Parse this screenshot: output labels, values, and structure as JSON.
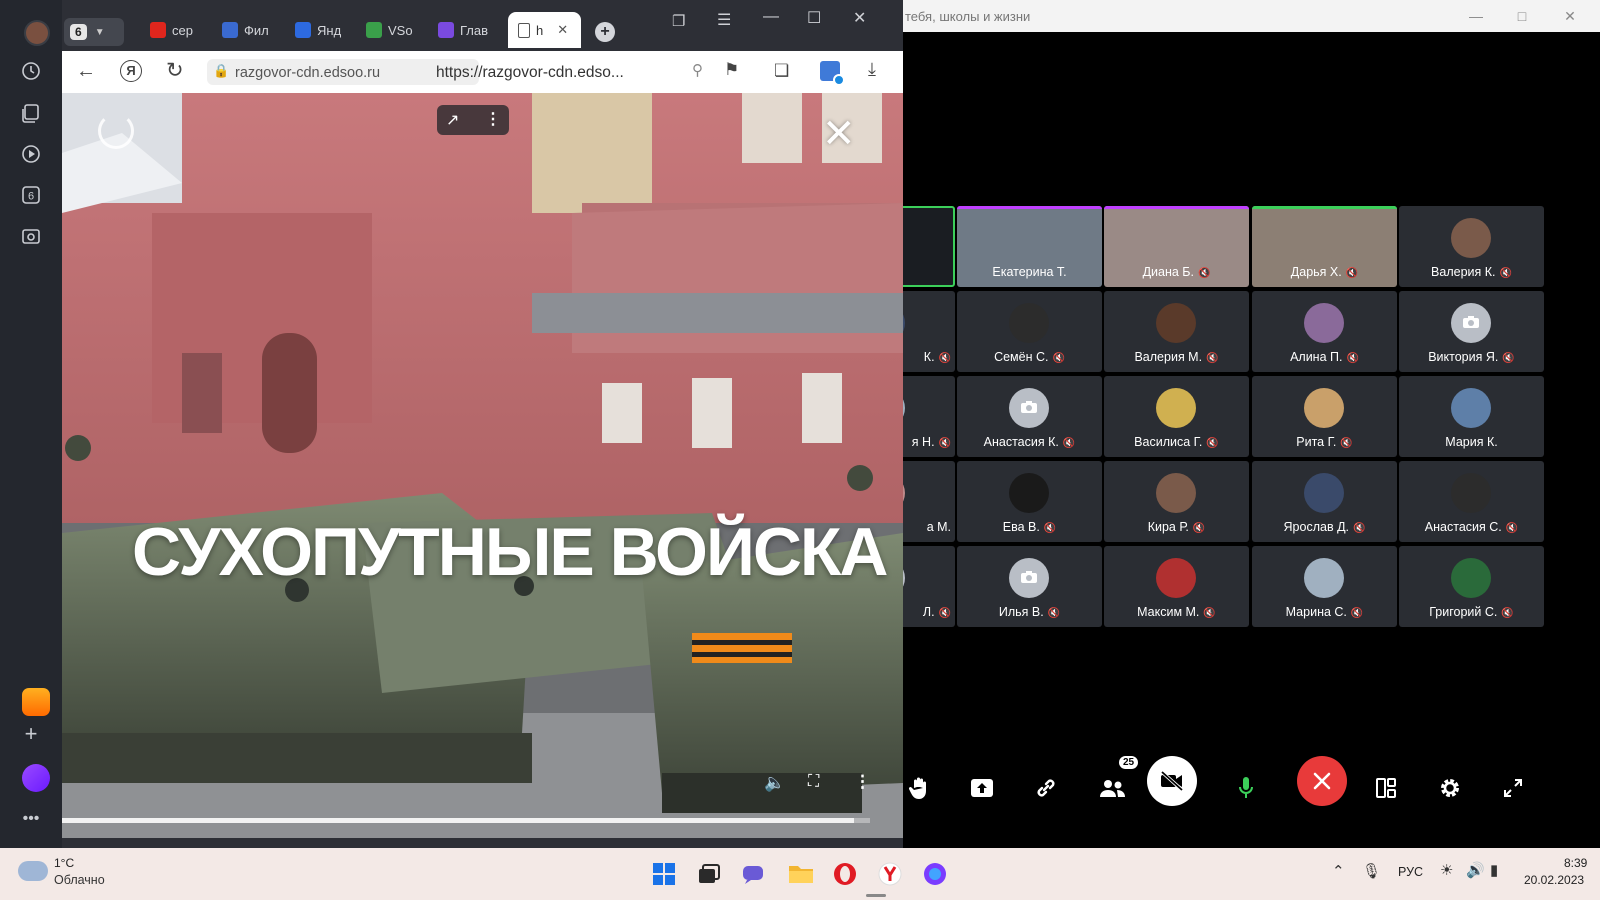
{
  "conference": {
    "window_title": "тебя, школы и жизни",
    "participant_count": "25",
    "tiles": [
      {
        "name": "",
        "kind": "screen",
        "row": 0,
        "col": 0
      },
      {
        "name": "Екатерина Т.",
        "kind": "video",
        "row": 0,
        "col": 1,
        "muted": false
      },
      {
        "name": "Диана Б.",
        "kind": "video",
        "row": 0,
        "col": 2,
        "muted": true
      },
      {
        "name": "Дарья Х.",
        "kind": "video",
        "row": 0,
        "col": 3,
        "muted": true
      },
      {
        "name": "Валерия К.",
        "kind": "avatar",
        "row": 0,
        "col": 4,
        "muted": true
      },
      {
        "name": "К.",
        "kind": "avatar",
        "row": 1,
        "col": 0,
        "muted": true
      },
      {
        "name": "Семён С.",
        "kind": "avatar",
        "row": 1,
        "col": 1,
        "muted": true
      },
      {
        "name": "Валерия М.",
        "kind": "avatar",
        "row": 1,
        "col": 2,
        "muted": true
      },
      {
        "name": "Алина П.",
        "kind": "avatar",
        "row": 1,
        "col": 3,
        "muted": true
      },
      {
        "name": "Виктория Я.",
        "kind": "camera",
        "row": 1,
        "col": 4,
        "muted": true
      },
      {
        "name": "я Н.",
        "kind": "avatar",
        "row": 2,
        "col": 0,
        "muted": true
      },
      {
        "name": "Анастасия К.",
        "kind": "camera",
        "row": 2,
        "col": 1,
        "muted": true
      },
      {
        "name": "Василиса Г.",
        "kind": "avatar",
        "row": 2,
        "col": 2,
        "muted": true
      },
      {
        "name": "Рита Г.",
        "kind": "avatar",
        "row": 2,
        "col": 3,
        "muted": true
      },
      {
        "name": "Мария К.",
        "kind": "avatar",
        "row": 2,
        "col": 4,
        "muted": false
      },
      {
        "name": "а М.",
        "kind": "avatar",
        "row": 3,
        "col": 0,
        "muted": false
      },
      {
        "name": "Ева В.",
        "kind": "avatar",
        "row": 3,
        "col": 1,
        "muted": true
      },
      {
        "name": "Кира Р.",
        "kind": "avatar",
        "row": 3,
        "col": 2,
        "muted": true
      },
      {
        "name": "Ярослав Д.",
        "kind": "avatar",
        "row": 3,
        "col": 3,
        "muted": true
      },
      {
        "name": "Анастасия С.",
        "kind": "avatar",
        "row": 3,
        "col": 4,
        "muted": true
      },
      {
        "name": "Л.",
        "kind": "camera",
        "row": 4,
        "col": 0,
        "muted": true
      },
      {
        "name": "Илья В.",
        "kind": "camera",
        "row": 4,
        "col": 1,
        "muted": true
      },
      {
        "name": "Максим М.",
        "kind": "avatar",
        "row": 4,
        "col": 2,
        "muted": true
      },
      {
        "name": "Марина С.",
        "kind": "avatar",
        "row": 4,
        "col": 3,
        "muted": true
      },
      {
        "name": "Григорий С.",
        "kind": "avatar",
        "row": 4,
        "col": 4,
        "muted": true
      }
    ],
    "avatar_colors": [
      "#c9a06a",
      "#5e7fa8",
      "#c08a8a",
      "#1a1a1a",
      "#7a5a4a",
      "#3a4a6a",
      "#2c2c2c",
      "#5a3a2a",
      "#8a6a9a",
      "#b03030",
      "#a0b0c0",
      "#2a6a3a",
      "#d0b050"
    ]
  },
  "browser": {
    "tab_count": "6",
    "tabs": [
      {
        "label": "сер",
        "favicon_color": "#e0261d"
      },
      {
        "label": "Фил",
        "favicon_color": "#3a6ad0"
      },
      {
        "label": "Янд",
        "favicon_color": "#2d6ae0"
      },
      {
        "label": "VSo",
        "favicon_color": "#3aa04a"
      },
      {
        "label": "Глав",
        "favicon_color": "#7a4ae0"
      }
    ],
    "active_tab": {
      "label": "h"
    },
    "domain": "razgovor-cdn.edsoo.ru",
    "url": "https://razgovor-cdn.edso..."
  },
  "video": {
    "caption": "СУХОПУТНЫЕ ВОЙСКА",
    "progress_percent": 98
  },
  "taskbar": {
    "weather_temp": "1°C",
    "weather_desc": "Облачно",
    "language": "РУС",
    "time": "8:39",
    "date": "20.02.2023"
  },
  "colors": {
    "hangup_red": "#e83a3a",
    "accent_green": "#3ccf5a",
    "accent_purple": "#c040ff"
  }
}
